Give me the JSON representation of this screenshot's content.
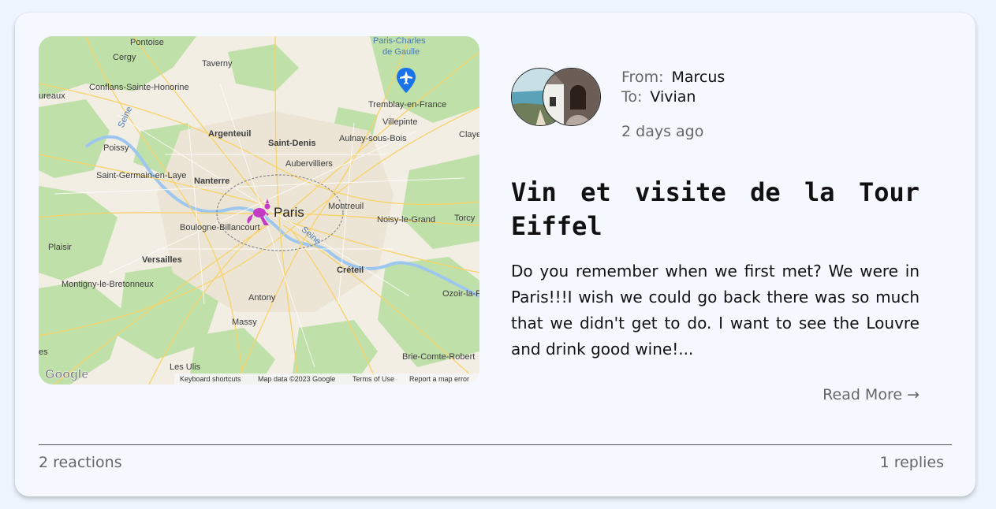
{
  "map": {
    "places": {
      "pontoise": "Pontoise",
      "cergy": "Cergy",
      "taverny": "Taverny",
      "cdg_1": "Paris-Charles",
      "cdg_2": "de Gaulle",
      "conflans": "Conflans-Sainte-Honorine",
      "eureaux": "ureaux",
      "seine_nw": "Seine",
      "tremblay": "Tremblay-en-France",
      "villepinte": "Villepinte",
      "claye": "Claye",
      "argenteuil": "Argenteuil",
      "saint_denis": "Saint-Denis",
      "aulnay": "Aulnay-sous-Bois",
      "poissy": "Poissy",
      "aubervilliers": "Aubervilliers",
      "saint_germain": "Saint-Germain-en-Laye",
      "nanterre": "Nanterre",
      "paris": "Paris",
      "montreuil": "Montreuil",
      "noisy": "Noisy-le-Grand",
      "torcy": "Torcy",
      "boulogne": "Boulogne-Billancourt",
      "seine_paris": "Seine",
      "plaisir": "Plaisir",
      "versailles": "Versailles",
      "creteil": "Créteil",
      "montigny": "Montigny-le-Bretonneux",
      "ozoir": "Ozoir-la-F",
      "antony": "Antony",
      "massy": "Massy",
      "les_w": "es",
      "brie": "Brie-Comte-Robert",
      "les_ulis": "Les Ulis"
    },
    "google_logo": "Google",
    "footer_links": {
      "shortcuts": "Keyboard shortcuts",
      "map_data": "Map data ©2023 Google",
      "terms": "Terms of Use",
      "report": "Report a map error"
    },
    "marker_icon": "kangaroo-icon",
    "airport_icon": "airplane-icon"
  },
  "post": {
    "from_label": "From:",
    "from_name": "Marcus",
    "to_label": "To:",
    "to_name": "Vivian",
    "timestamp": "2 days ago",
    "title": "Vin et visite de la Tour Eiffel",
    "excerpt": "Do you remember when we first met? We were in Paris!!!I wish we could go back there was so much that we didn't get to do. I want to see the Louvre and drink good wine!...",
    "read_more": "Read More →"
  },
  "footer": {
    "reactions": "2 reactions",
    "replies": "1 replies"
  },
  "colors": {
    "page_background": "#edf4fd",
    "card_background": "#f5f9ff",
    "marker": "#c43bc4",
    "airport_pin": "#1a73e8"
  }
}
